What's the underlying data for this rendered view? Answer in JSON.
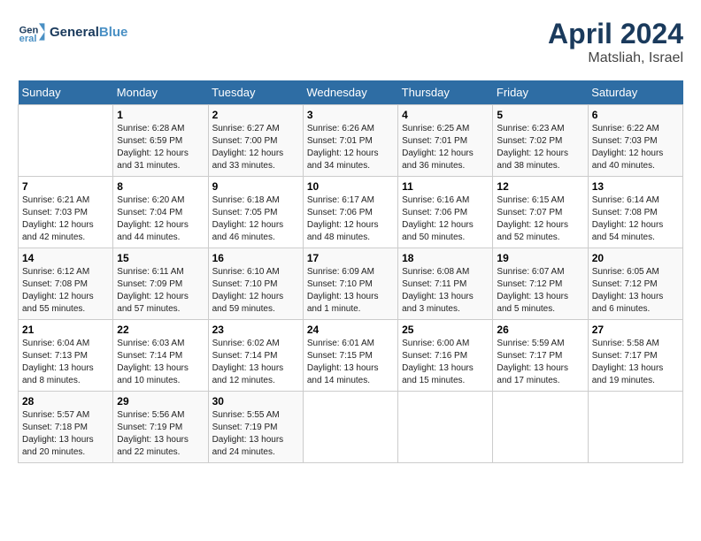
{
  "logo": {
    "text_general": "General",
    "text_blue": "Blue"
  },
  "header": {
    "month": "April 2024",
    "location": "Matsliah, Israel"
  },
  "weekdays": [
    "Sunday",
    "Monday",
    "Tuesday",
    "Wednesday",
    "Thursday",
    "Friday",
    "Saturday"
  ],
  "weeks": [
    [
      {
        "day": null,
        "sunrise": null,
        "sunset": null,
        "daylight": null
      },
      {
        "day": "1",
        "sunrise": "Sunrise: 6:28 AM",
        "sunset": "Sunset: 6:59 PM",
        "daylight": "Daylight: 12 hours and 31 minutes."
      },
      {
        "day": "2",
        "sunrise": "Sunrise: 6:27 AM",
        "sunset": "Sunset: 7:00 PM",
        "daylight": "Daylight: 12 hours and 33 minutes."
      },
      {
        "day": "3",
        "sunrise": "Sunrise: 6:26 AM",
        "sunset": "Sunset: 7:01 PM",
        "daylight": "Daylight: 12 hours and 34 minutes."
      },
      {
        "day": "4",
        "sunrise": "Sunrise: 6:25 AM",
        "sunset": "Sunset: 7:01 PM",
        "daylight": "Daylight: 12 hours and 36 minutes."
      },
      {
        "day": "5",
        "sunrise": "Sunrise: 6:23 AM",
        "sunset": "Sunset: 7:02 PM",
        "daylight": "Daylight: 12 hours and 38 minutes."
      },
      {
        "day": "6",
        "sunrise": "Sunrise: 6:22 AM",
        "sunset": "Sunset: 7:03 PM",
        "daylight": "Daylight: 12 hours and 40 minutes."
      }
    ],
    [
      {
        "day": "7",
        "sunrise": "Sunrise: 6:21 AM",
        "sunset": "Sunset: 7:03 PM",
        "daylight": "Daylight: 12 hours and 42 minutes."
      },
      {
        "day": "8",
        "sunrise": "Sunrise: 6:20 AM",
        "sunset": "Sunset: 7:04 PM",
        "daylight": "Daylight: 12 hours and 44 minutes."
      },
      {
        "day": "9",
        "sunrise": "Sunrise: 6:18 AM",
        "sunset": "Sunset: 7:05 PM",
        "daylight": "Daylight: 12 hours and 46 minutes."
      },
      {
        "day": "10",
        "sunrise": "Sunrise: 6:17 AM",
        "sunset": "Sunset: 7:06 PM",
        "daylight": "Daylight: 12 hours and 48 minutes."
      },
      {
        "day": "11",
        "sunrise": "Sunrise: 6:16 AM",
        "sunset": "Sunset: 7:06 PM",
        "daylight": "Daylight: 12 hours and 50 minutes."
      },
      {
        "day": "12",
        "sunrise": "Sunrise: 6:15 AM",
        "sunset": "Sunset: 7:07 PM",
        "daylight": "Daylight: 12 hours and 52 minutes."
      },
      {
        "day": "13",
        "sunrise": "Sunrise: 6:14 AM",
        "sunset": "Sunset: 7:08 PM",
        "daylight": "Daylight: 12 hours and 54 minutes."
      }
    ],
    [
      {
        "day": "14",
        "sunrise": "Sunrise: 6:12 AM",
        "sunset": "Sunset: 7:08 PM",
        "daylight": "Daylight: 12 hours and 55 minutes."
      },
      {
        "day": "15",
        "sunrise": "Sunrise: 6:11 AM",
        "sunset": "Sunset: 7:09 PM",
        "daylight": "Daylight: 12 hours and 57 minutes."
      },
      {
        "day": "16",
        "sunrise": "Sunrise: 6:10 AM",
        "sunset": "Sunset: 7:10 PM",
        "daylight": "Daylight: 12 hours and 59 minutes."
      },
      {
        "day": "17",
        "sunrise": "Sunrise: 6:09 AM",
        "sunset": "Sunset: 7:10 PM",
        "daylight": "Daylight: 13 hours and 1 minute."
      },
      {
        "day": "18",
        "sunrise": "Sunrise: 6:08 AM",
        "sunset": "Sunset: 7:11 PM",
        "daylight": "Daylight: 13 hours and 3 minutes."
      },
      {
        "day": "19",
        "sunrise": "Sunrise: 6:07 AM",
        "sunset": "Sunset: 7:12 PM",
        "daylight": "Daylight: 13 hours and 5 minutes."
      },
      {
        "day": "20",
        "sunrise": "Sunrise: 6:05 AM",
        "sunset": "Sunset: 7:12 PM",
        "daylight": "Daylight: 13 hours and 6 minutes."
      }
    ],
    [
      {
        "day": "21",
        "sunrise": "Sunrise: 6:04 AM",
        "sunset": "Sunset: 7:13 PM",
        "daylight": "Daylight: 13 hours and 8 minutes."
      },
      {
        "day": "22",
        "sunrise": "Sunrise: 6:03 AM",
        "sunset": "Sunset: 7:14 PM",
        "daylight": "Daylight: 13 hours and 10 minutes."
      },
      {
        "day": "23",
        "sunrise": "Sunrise: 6:02 AM",
        "sunset": "Sunset: 7:14 PM",
        "daylight": "Daylight: 13 hours and 12 minutes."
      },
      {
        "day": "24",
        "sunrise": "Sunrise: 6:01 AM",
        "sunset": "Sunset: 7:15 PM",
        "daylight": "Daylight: 13 hours and 14 minutes."
      },
      {
        "day": "25",
        "sunrise": "Sunrise: 6:00 AM",
        "sunset": "Sunset: 7:16 PM",
        "daylight": "Daylight: 13 hours and 15 minutes."
      },
      {
        "day": "26",
        "sunrise": "Sunrise: 5:59 AM",
        "sunset": "Sunset: 7:17 PM",
        "daylight": "Daylight: 13 hours and 17 minutes."
      },
      {
        "day": "27",
        "sunrise": "Sunrise: 5:58 AM",
        "sunset": "Sunset: 7:17 PM",
        "daylight": "Daylight: 13 hours and 19 minutes."
      }
    ],
    [
      {
        "day": "28",
        "sunrise": "Sunrise: 5:57 AM",
        "sunset": "Sunset: 7:18 PM",
        "daylight": "Daylight: 13 hours and 20 minutes."
      },
      {
        "day": "29",
        "sunrise": "Sunrise: 5:56 AM",
        "sunset": "Sunset: 7:19 PM",
        "daylight": "Daylight: 13 hours and 22 minutes."
      },
      {
        "day": "30",
        "sunrise": "Sunrise: 5:55 AM",
        "sunset": "Sunset: 7:19 PM",
        "daylight": "Daylight: 13 hours and 24 minutes."
      },
      {
        "day": null,
        "sunrise": null,
        "sunset": null,
        "daylight": null
      },
      {
        "day": null,
        "sunrise": null,
        "sunset": null,
        "daylight": null
      },
      {
        "day": null,
        "sunrise": null,
        "sunset": null,
        "daylight": null
      },
      {
        "day": null,
        "sunrise": null,
        "sunset": null,
        "daylight": null
      }
    ]
  ]
}
